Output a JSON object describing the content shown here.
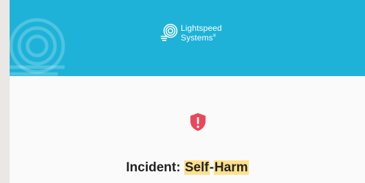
{
  "brand": {
    "line1": "Lightspeed",
    "line2": "Systems",
    "registered": "®"
  },
  "incident": {
    "prefix": "Incident:",
    "term1": "Self",
    "separator": "-",
    "term2": "Harm"
  },
  "colors": {
    "banner": "#1eb2d8",
    "alert": "#e8485a",
    "highlight": "#ffe08a",
    "background": "#fafafa"
  },
  "icons": {
    "logo": "lightspeed-logo-icon",
    "alert": "shield-alert-icon"
  }
}
